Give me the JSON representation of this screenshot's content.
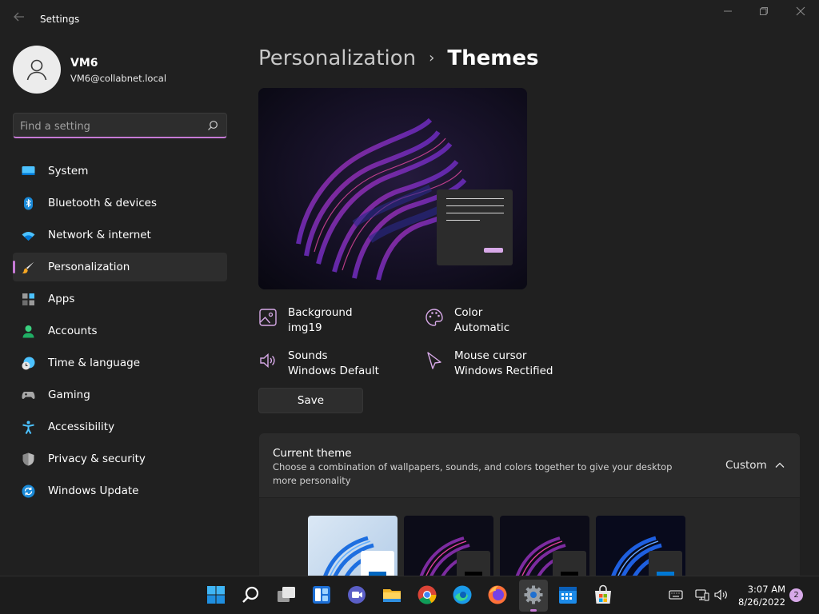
{
  "window": {
    "title": "Settings",
    "controls": [
      "minimize",
      "restore",
      "close"
    ]
  },
  "profile": {
    "name": "VM6",
    "email": "VM6@collabnet.local"
  },
  "search": {
    "placeholder": "Find a setting",
    "value": ""
  },
  "sidebar": {
    "items": [
      {
        "label": "System",
        "icon": "monitor-icon"
      },
      {
        "label": "Bluetooth & devices",
        "icon": "bluetooth-icon"
      },
      {
        "label": "Network & internet",
        "icon": "wifi-icon"
      },
      {
        "label": "Personalization",
        "icon": "paintbrush-icon",
        "selected": true
      },
      {
        "label": "Apps",
        "icon": "apps-icon"
      },
      {
        "label": "Accounts",
        "icon": "person-icon"
      },
      {
        "label": "Time & language",
        "icon": "clock-globe-icon"
      },
      {
        "label": "Gaming",
        "icon": "gamepad-icon"
      },
      {
        "label": "Accessibility",
        "icon": "accessibility-icon"
      },
      {
        "label": "Privacy & security",
        "icon": "shield-icon"
      },
      {
        "label": "Windows Update",
        "icon": "update-icon"
      }
    ]
  },
  "main": {
    "breadcrumb": {
      "parent": "Personalization",
      "separator": "›",
      "current": "Themes"
    },
    "properties": [
      {
        "title": "Background",
        "value": "img19",
        "icon": "image-icon"
      },
      {
        "title": "Color",
        "value": "Automatic",
        "icon": "palette-icon"
      },
      {
        "title": "Sounds",
        "value": "Windows Default",
        "icon": "speaker-icon"
      },
      {
        "title": "Mouse cursor",
        "value": "Windows Rectified",
        "icon": "cursor-icon"
      }
    ],
    "save_label": "Save",
    "current_theme": {
      "title": "Current theme",
      "description": "Choose a combination of wallpapers, sounds, and colors together to give your desktop more personality",
      "value": "Custom",
      "expanded": true,
      "themes": [
        {
          "name": "windows-light",
          "style": "light"
        },
        {
          "name": "windows-dark-glow-1",
          "style": "dark"
        },
        {
          "name": "windows-dark-glow-2",
          "style": "dark"
        },
        {
          "name": "windows-dark",
          "style": "dark-blue"
        }
      ]
    }
  },
  "taskbar": {
    "apps": [
      "start",
      "search",
      "task-view",
      "widgets",
      "teams-chat",
      "file-explorer",
      "chrome",
      "edge",
      "firefox",
      "settings",
      "calendar",
      "store"
    ],
    "active_app": "settings",
    "time": "3:07 AM",
    "date": "8/26/2022",
    "notification_count": "2"
  },
  "colors": {
    "accent": "#c67ad6",
    "accent_light": "#d7a9e8",
    "background": "#202020",
    "card": "#2b2b2b"
  }
}
